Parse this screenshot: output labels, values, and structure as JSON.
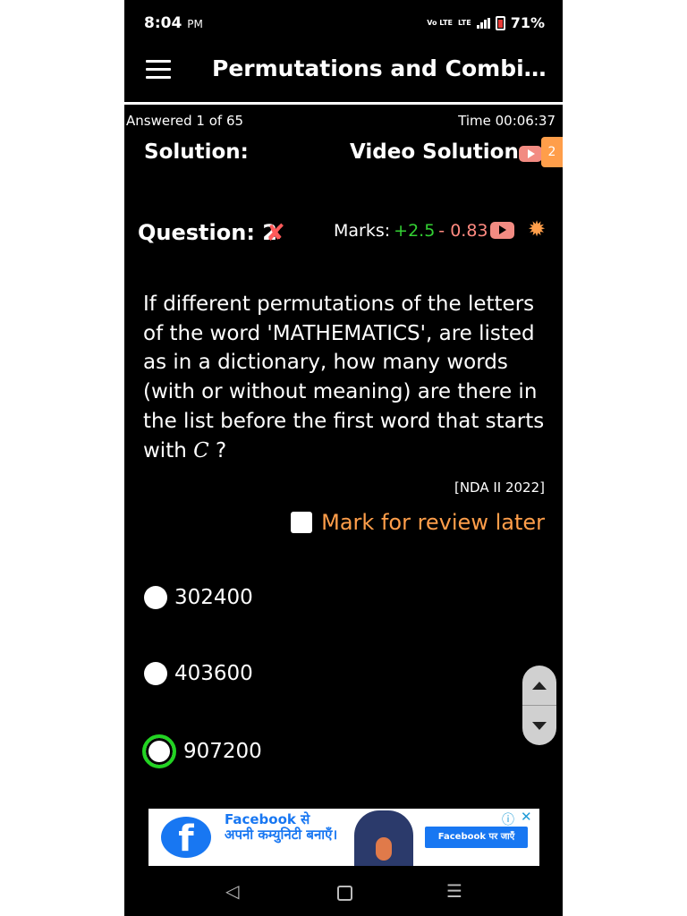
{
  "status_bar": {
    "time": "8:04",
    "ampm": "PM",
    "network_volte": "Vo LTE",
    "network_lte": "LTE",
    "battery": "71%"
  },
  "app_bar": {
    "title": "Permutations and Combinati..."
  },
  "progress": {
    "answered": "Answered 1 of 65",
    "timer": "Time 00:06:37"
  },
  "solution_row": {
    "solution_label": "Solution:",
    "video_solution_label": "Video Solution:",
    "video_count": "2"
  },
  "question_header": {
    "label": "Question: 2",
    "result_icon": "cross-mark-icon",
    "marks_label": "Marks:",
    "marks_positive": "+2.5",
    "marks_negative": "- 0.83",
    "icons": [
      "youtube-icon",
      "bug-icon"
    ]
  },
  "question": {
    "text_before": "If different permutations of the letters of the word 'MATHEMATICS', are listed as in a dictionary, how many words (with or without meaning) are there in the list before the first word that starts with ",
    "math": "C",
    "text_after": " ?",
    "source": "[NDA II 2022]"
  },
  "review": {
    "label": "Mark for review later",
    "checked": false
  },
  "options": [
    {
      "value": "302400",
      "selected": false
    },
    {
      "value": "403600",
      "selected": false
    },
    {
      "value": "907200",
      "selected": true
    }
  ],
  "ad": {
    "headline": "Facebook से अपनी कम्युनिटी बनाएँ।",
    "cta": "Facebook पर जाएँ",
    "logo_letter": "f",
    "info_icon": "ⓘ",
    "close_icon": "✕"
  },
  "colors": {
    "background": "#000000",
    "accent_orange": "#ff9e4a",
    "positive_green": "#33d033",
    "negative_red": "#ff8a80",
    "selected_ring": "#22d422",
    "facebook_blue": "#1877f2"
  },
  "nav_bar": {
    "back": "◁",
    "menu": "☰"
  }
}
